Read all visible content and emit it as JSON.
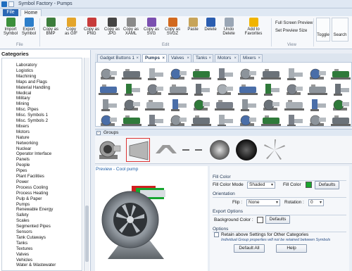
{
  "window": {
    "title": "Symbol Factory - Pumps"
  },
  "ribbon": {
    "tabs": {
      "file": "File",
      "home": "Home"
    },
    "buttons": [
      {
        "label": "Import\nSymbol",
        "icon": "import-icon",
        "color": "#3b8f3b"
      },
      {
        "label": "Export\nSymbol",
        "icon": "export-icon",
        "color": "#2d7ec9"
      },
      {
        "label": "Copy as\nBMP",
        "icon": "bmp-icon",
        "color": "#3c7d3c"
      },
      {
        "label": "Copy\nas GIF",
        "icon": "gif-icon",
        "color": "#e4a52b"
      },
      {
        "label": "Copy as\nPNG",
        "icon": "png-icon",
        "color": "#c73b3b"
      },
      {
        "label": "Copy as\nJPG",
        "icon": "jpg-icon",
        "color": "#444444"
      },
      {
        "label": "Copy as\nXAML",
        "icon": "xaml-icon",
        "color": "#8a8a8a"
      },
      {
        "label": "Copy as\nSVG",
        "icon": "svg-icon",
        "color": "#7a4fb0"
      },
      {
        "label": "Copy as\nSVGZ",
        "icon": "svgz-icon",
        "color": "#d2691e"
      },
      {
        "label": "Paste",
        "icon": "paste-icon",
        "color": "#c7a45a"
      },
      {
        "label": "Delete",
        "icon": "delete-icon",
        "color": "#2a5db0"
      },
      {
        "label": "Undo\nDelete",
        "icon": "undo-icon",
        "color": "#9aa6b5"
      },
      {
        "label": "Add to\nFavorites",
        "icon": "star-icon",
        "color": "#f0b400"
      }
    ],
    "groups": {
      "file": "File",
      "edit": "Edit",
      "view": "View"
    },
    "view": {
      "full_screen": "Full Screen Preview",
      "set_size": "Set Preview Size"
    },
    "toggle": "Toggle",
    "search": "Search"
  },
  "categories": {
    "header": "Categories",
    "items": [
      "Laboratory",
      "Logistics",
      "Machining",
      "Maps and Flags",
      "Material Handling",
      "Medical",
      "Military",
      "Mining",
      "Misc. Pipes",
      "Misc. Symbols 1",
      "Misc. Symbols 2",
      "Mixers",
      "Motors",
      "Nature",
      "Networking",
      "Nuclear",
      "Operator Interface",
      "Panels",
      "People",
      "Pipes",
      "Plant Facilities",
      "Power",
      "Process Cooling",
      "Process Heating",
      "Pulp & Paper",
      "Pumps",
      "Renewable Energy",
      "Safety",
      "Scales",
      "Segmented Pipes",
      "Sensors",
      "Tank Cutaways",
      "Tanks",
      "Textures",
      "Valves",
      "Vehicles",
      "Water & Wastewater"
    ]
  },
  "doc_tabs": [
    "Gadget Buttons 1",
    "Pumps",
    "Valves",
    "Tanks",
    "Motors",
    "Mixers"
  ],
  "groups": {
    "label": "Groups"
  },
  "preview": {
    "title": "Preview - Cool pump"
  },
  "props": {
    "fill_color": {
      "section": "Fill Color",
      "mode_label": "Fill Color Mode",
      "mode_value": "Shaded",
      "color_label": "Fill Color",
      "color_value": "#1aa52d",
      "defaults_button": "Defaults"
    },
    "orientation": {
      "section": "Orientation",
      "flip_label": "Flip :",
      "flip_value": "None",
      "rotation_label": "Rotation :",
      "rotation_value": "0"
    },
    "export": {
      "section": "Export Options",
      "bg_label": "Background Color :",
      "defaults_button": "Defaults"
    },
    "options": {
      "section": "Options",
      "retain_label": "Retain above Settings for Other Categories",
      "note": "Individual Group properties will not be retained between Symbols"
    },
    "default_all_button": "Default All",
    "help_button": "Help"
  }
}
